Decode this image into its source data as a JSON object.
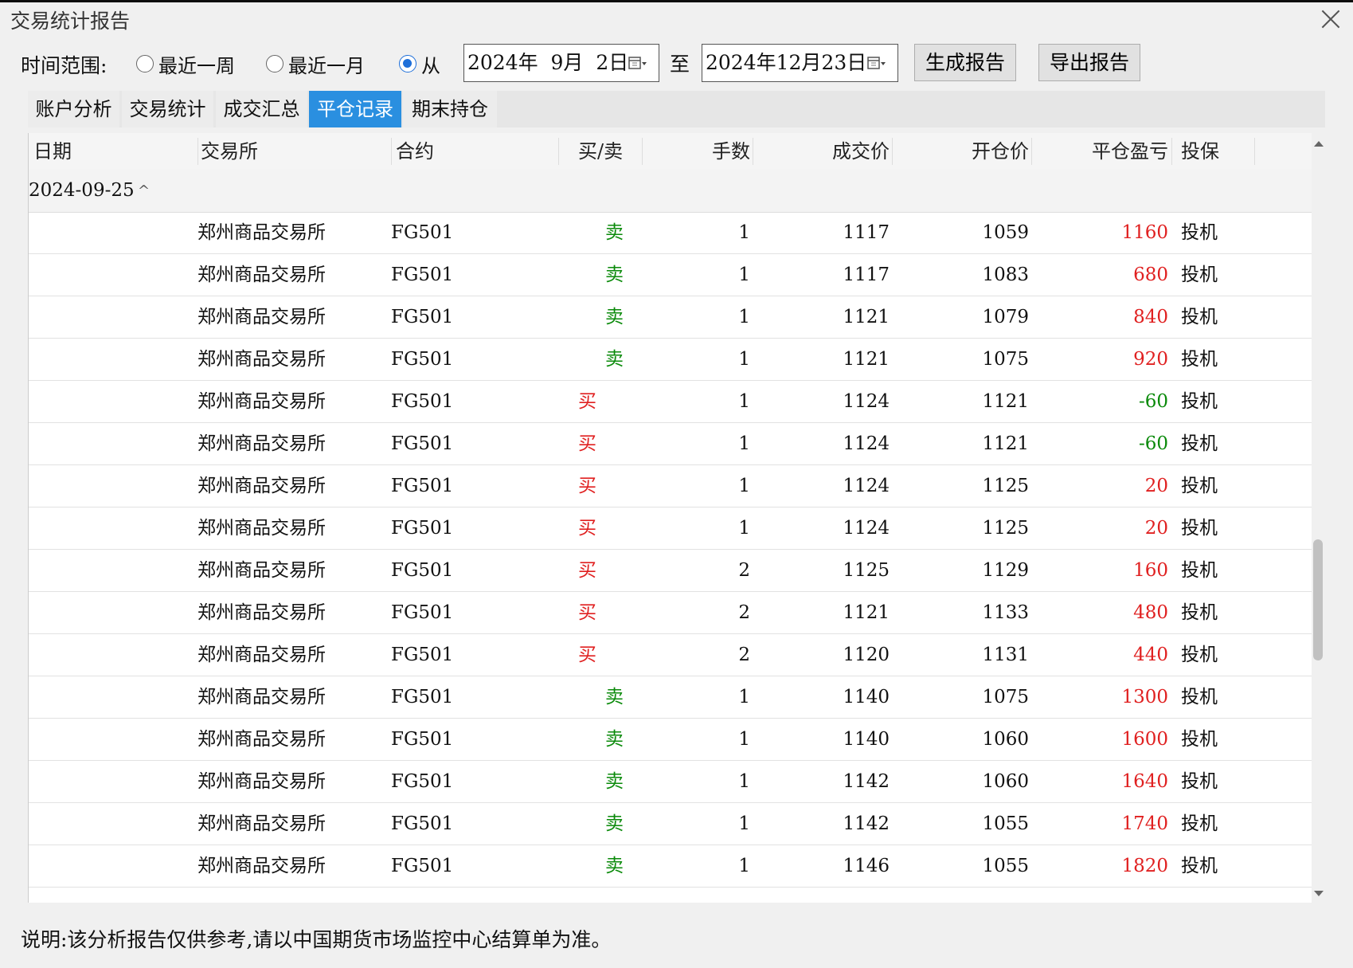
{
  "window": {
    "title": "交易统计报告"
  },
  "toolbar": {
    "range_label": "时间范围:",
    "options": [
      {
        "label": "最近一周",
        "checked": false
      },
      {
        "label": "最近一月",
        "checked": false
      },
      {
        "label": "从",
        "checked": true
      }
    ],
    "date_from": "2024年  9月  2日",
    "to_label": "至",
    "date_to": "2024年12月23日",
    "generate_label": "生成报告",
    "export_label": "导出报告"
  },
  "tabs": [
    {
      "label": "账户分析",
      "active": false
    },
    {
      "label": "交易统计",
      "active": false
    },
    {
      "label": "成交汇总",
      "active": false
    },
    {
      "label": "平仓记录",
      "active": true
    },
    {
      "label": "期末持仓",
      "active": false
    }
  ],
  "table": {
    "columns": [
      "日期",
      "交易所",
      "合约",
      "买/卖",
      "手数",
      "成交价",
      "开仓价",
      "平仓盈亏",
      "投保"
    ],
    "group_date": "2024-09-25",
    "rows": [
      {
        "exchange": "郑州商品交易所",
        "contract": "FG501",
        "side": "卖",
        "lots": "1",
        "price": "1117",
        "open": "1059",
        "pnl": "1160",
        "hedge": "投机"
      },
      {
        "exchange": "郑州商品交易所",
        "contract": "FG501",
        "side": "卖",
        "lots": "1",
        "price": "1117",
        "open": "1083",
        "pnl": "680",
        "hedge": "投机"
      },
      {
        "exchange": "郑州商品交易所",
        "contract": "FG501",
        "side": "卖",
        "lots": "1",
        "price": "1121",
        "open": "1079",
        "pnl": "840",
        "hedge": "投机"
      },
      {
        "exchange": "郑州商品交易所",
        "contract": "FG501",
        "side": "卖",
        "lots": "1",
        "price": "1121",
        "open": "1075",
        "pnl": "920",
        "hedge": "投机"
      },
      {
        "exchange": "郑州商品交易所",
        "contract": "FG501",
        "side": "买",
        "lots": "1",
        "price": "1124",
        "open": "1121",
        "pnl": "-60",
        "hedge": "投机"
      },
      {
        "exchange": "郑州商品交易所",
        "contract": "FG501",
        "side": "买",
        "lots": "1",
        "price": "1124",
        "open": "1121",
        "pnl": "-60",
        "hedge": "投机"
      },
      {
        "exchange": "郑州商品交易所",
        "contract": "FG501",
        "side": "买",
        "lots": "1",
        "price": "1124",
        "open": "1125",
        "pnl": "20",
        "hedge": "投机"
      },
      {
        "exchange": "郑州商品交易所",
        "contract": "FG501",
        "side": "买",
        "lots": "1",
        "price": "1124",
        "open": "1125",
        "pnl": "20",
        "hedge": "投机"
      },
      {
        "exchange": "郑州商品交易所",
        "contract": "FG501",
        "side": "买",
        "lots": "2",
        "price": "1125",
        "open": "1129",
        "pnl": "160",
        "hedge": "投机"
      },
      {
        "exchange": "郑州商品交易所",
        "contract": "FG501",
        "side": "买",
        "lots": "2",
        "price": "1121",
        "open": "1133",
        "pnl": "480",
        "hedge": "投机"
      },
      {
        "exchange": "郑州商品交易所",
        "contract": "FG501",
        "side": "买",
        "lots": "2",
        "price": "1120",
        "open": "1131",
        "pnl": "440",
        "hedge": "投机"
      },
      {
        "exchange": "郑州商品交易所",
        "contract": "FG501",
        "side": "卖",
        "lots": "1",
        "price": "1140",
        "open": "1075",
        "pnl": "1300",
        "hedge": "投机"
      },
      {
        "exchange": "郑州商品交易所",
        "contract": "FG501",
        "side": "卖",
        "lots": "1",
        "price": "1140",
        "open": "1060",
        "pnl": "1600",
        "hedge": "投机"
      },
      {
        "exchange": "郑州商品交易所",
        "contract": "FG501",
        "side": "卖",
        "lots": "1",
        "price": "1142",
        "open": "1060",
        "pnl": "1640",
        "hedge": "投机"
      },
      {
        "exchange": "郑州商品交易所",
        "contract": "FG501",
        "side": "卖",
        "lots": "1",
        "price": "1142",
        "open": "1055",
        "pnl": "1740",
        "hedge": "投机"
      },
      {
        "exchange": "郑州商品交易所",
        "contract": "FG501",
        "side": "卖",
        "lots": "1",
        "price": "1146",
        "open": "1055",
        "pnl": "1820",
        "hedge": "投机"
      }
    ]
  },
  "colors": {
    "buy": "#e02020",
    "sell": "#0a8a0a",
    "profit": "#e02020",
    "loss": "#0a8a0a",
    "accent": "#2a8fe0"
  },
  "footer": {
    "note": "说明:该分析报告仅供参考,请以中国期货市场监控中心结算单为准。"
  }
}
